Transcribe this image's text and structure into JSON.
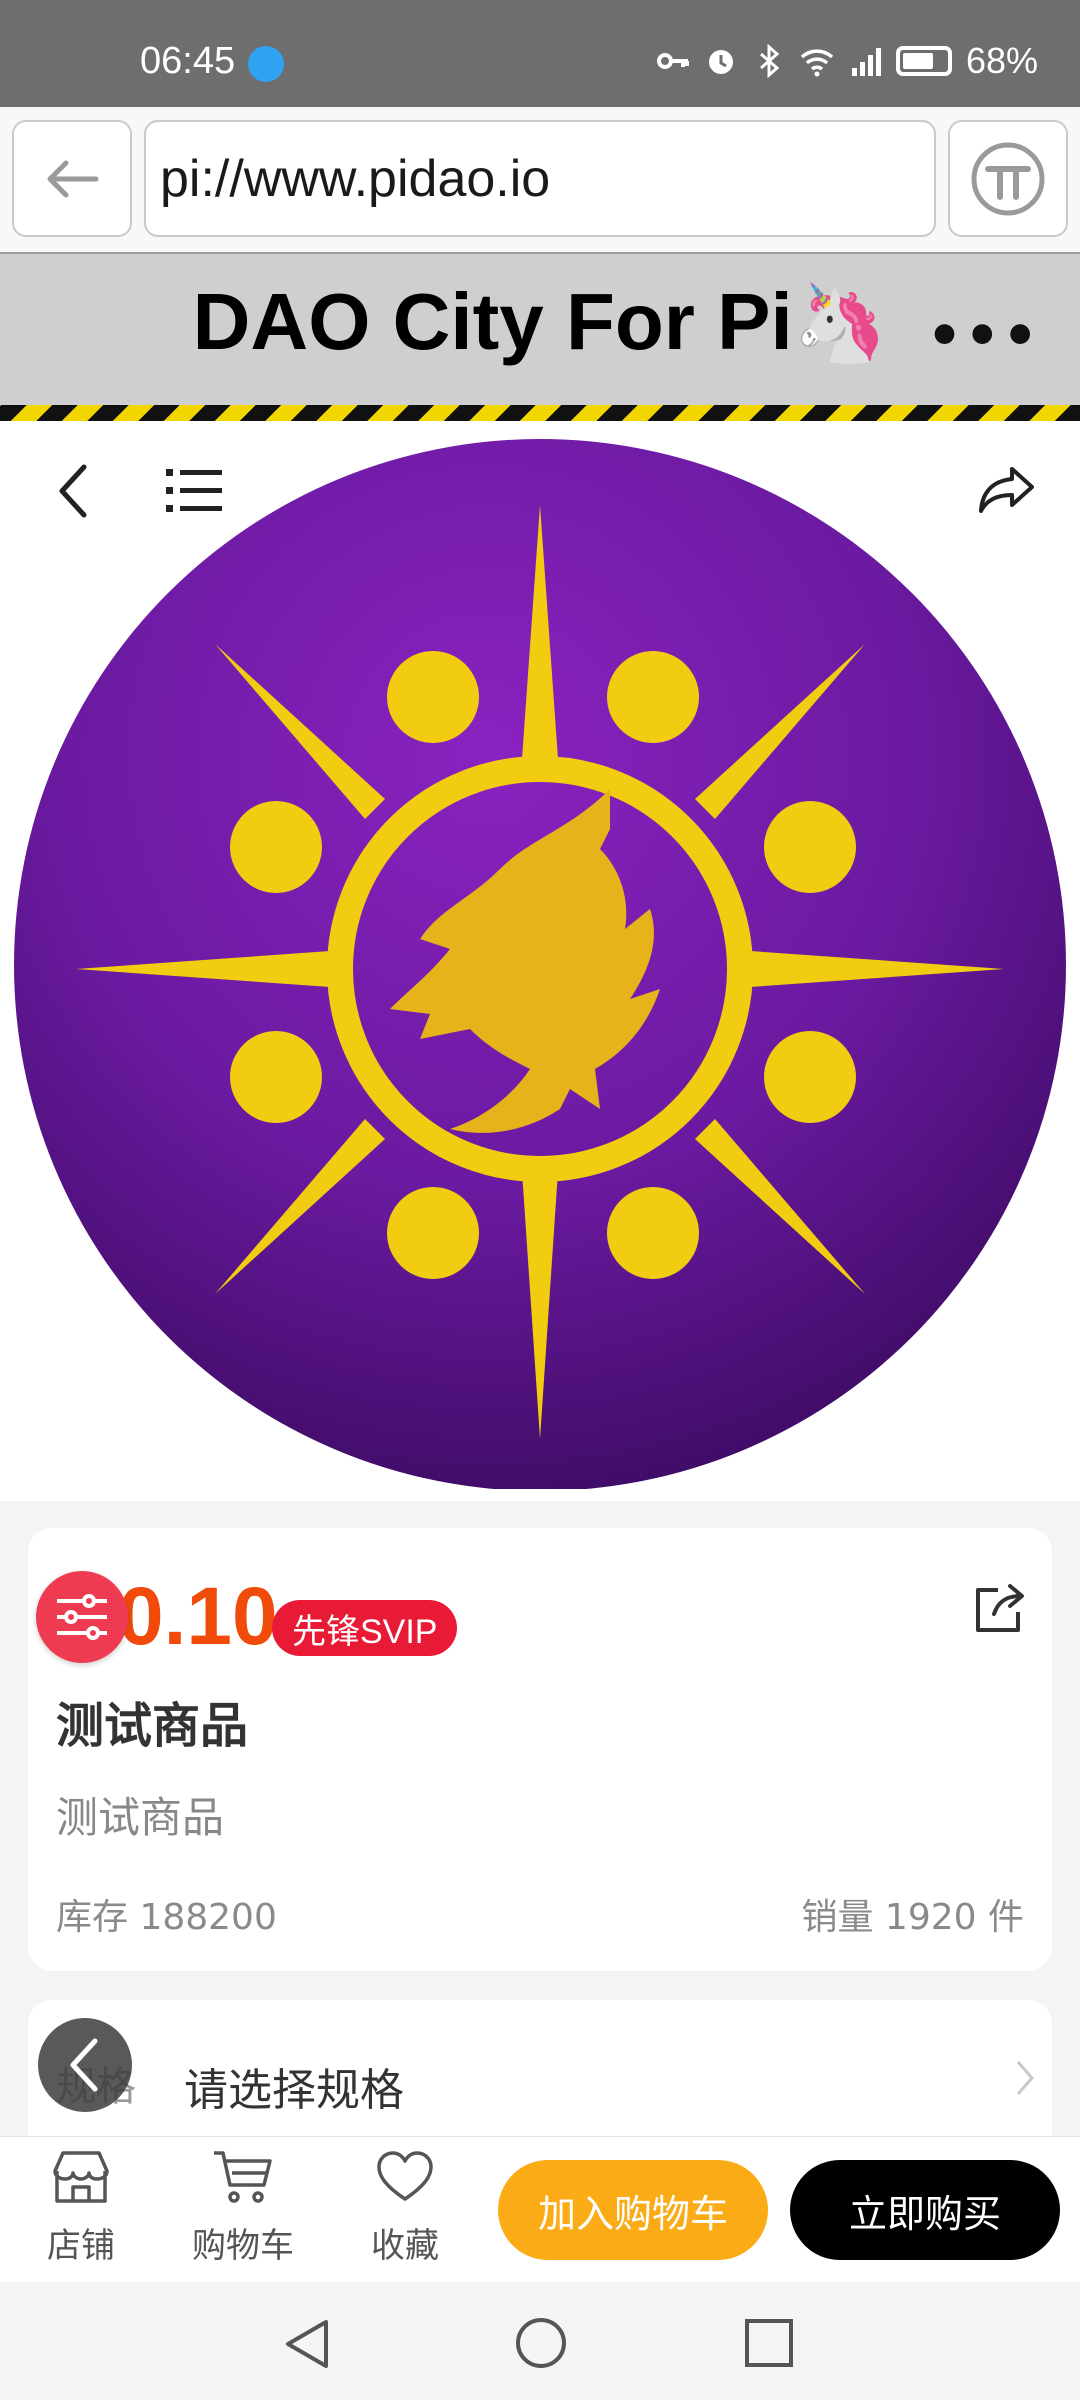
{
  "status_bar": {
    "time": "06:45",
    "battery": "68%"
  },
  "browser": {
    "url": "pi://www.pidao.io"
  },
  "site_header": {
    "title": "DAO City For Pi",
    "title_emoji": "🦄",
    "more": "•••"
  },
  "product": {
    "price": "0.10",
    "badge": "先锋SVIP",
    "name": "测试商品",
    "description": "测试商品",
    "stock_label": "库存 188200",
    "sales_label": "销量 1920 件"
  },
  "spec": {
    "label": "规格",
    "value": "请选择规格"
  },
  "action_bar": {
    "store": "店铺",
    "cart": "购物车",
    "favorite": "收藏",
    "add_to_cart": "加入购物车",
    "buy_now": "立即购买"
  },
  "colors": {
    "price": "#f04b0a",
    "svip_badge": "#e91a35",
    "add_to_cart": "#fbab16",
    "buy_now": "#000000",
    "logo_purple": "#6a1aa0",
    "logo_gold": "#f2cc10"
  }
}
